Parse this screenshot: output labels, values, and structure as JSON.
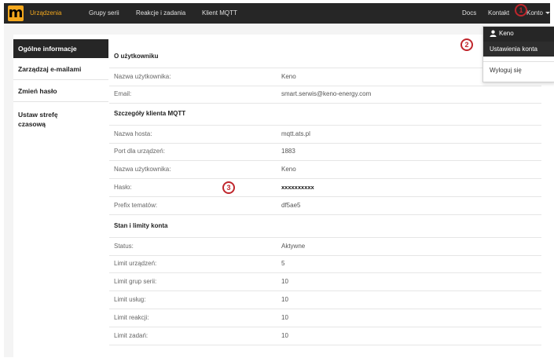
{
  "navbar": {
    "logo_letter": "m",
    "links": [
      "Urządzenia",
      "Grupy serii",
      "Reakcje i zadania",
      "Klient MQTT"
    ],
    "docs": "Docs",
    "contact": "Kontakt",
    "account": "Konto",
    "accent_color": "#f4a81d",
    "background_color": "#262626"
  },
  "annotations": [
    "1",
    "2",
    "3"
  ],
  "dropdown": {
    "user": "Keno",
    "settings": "Ustawienia konta",
    "logout": "Wyloguj się"
  },
  "sidebar": {
    "items": [
      "Ogólne informacje",
      "Zarządzaj e-mailami",
      "Zmień hasło",
      "Ustaw strefę czasową"
    ]
  },
  "sections": {
    "user": {
      "title": "O użytkowniku",
      "rows": [
        {
          "label": "Nazwa użytkownika:",
          "value": "Keno"
        },
        {
          "label": "Email:",
          "value": "smart.serwis@keno-energy.com"
        }
      ]
    },
    "mqtt": {
      "title": "Szczegóły klienta MQTT",
      "rows": [
        {
          "label": "Nazwa hosta:",
          "value": "mqtt.ats.pl"
        },
        {
          "label": "Port dla urządzeń:",
          "value": "1883"
        },
        {
          "label": "Nazwa użytkownika:",
          "value": "Keno"
        },
        {
          "label": "Hasło:",
          "value": "xxxxxxxxxx"
        },
        {
          "label": "Prefix tematów:",
          "value": "df5ae5"
        }
      ]
    },
    "account": {
      "title": "Stan i limity konta",
      "rows": [
        {
          "label": "Status:",
          "value": "Aktywne"
        },
        {
          "label": "Limit urządzeń:",
          "value": "5"
        },
        {
          "label": "Limit grup serii:",
          "value": "10"
        },
        {
          "label": "Limit usług:",
          "value": "10"
        },
        {
          "label": "Limit reakcji:",
          "value": "10"
        },
        {
          "label": "Limit zadań:",
          "value": "10"
        }
      ]
    }
  }
}
